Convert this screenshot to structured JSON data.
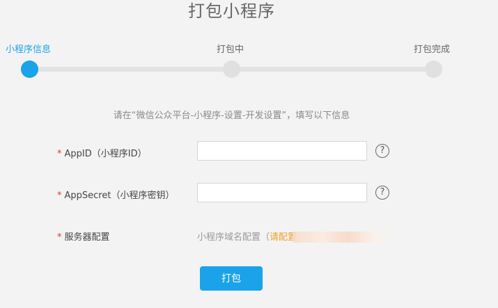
{
  "page": {
    "title": "打包小程序"
  },
  "steps": [
    {
      "label": "小程序信息",
      "active": true
    },
    {
      "label": "打包中",
      "active": false
    },
    {
      "label": "打包完成",
      "active": false
    }
  ],
  "hint": "请在“微信公众平台-小程序-设置-开发设置”，填写以下信息",
  "form": {
    "required_mark": "*",
    "appid": {
      "label": "AppID（小程序ID）",
      "value": "",
      "help": "?"
    },
    "appsecret": {
      "label": "AppSecret（小程序密钥）",
      "value": "",
      "help": "?"
    },
    "server": {
      "label": "服务器配置",
      "domain_text": "小程序域名配置（",
      "domain_link": "请配置:"
    }
  },
  "actions": {
    "pack_label": "打包"
  },
  "colors": {
    "accent": "#1aa3e8",
    "required": "#e2352f",
    "link": "#f0a020"
  }
}
